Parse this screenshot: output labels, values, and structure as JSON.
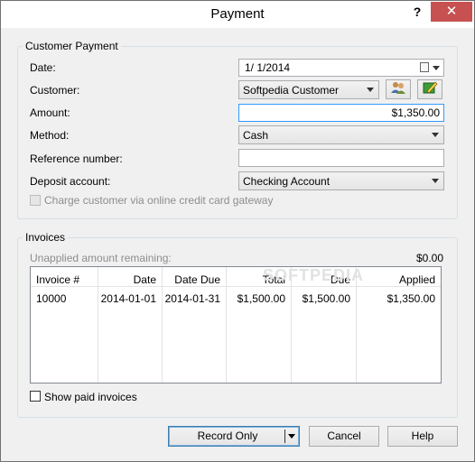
{
  "window": {
    "title": "Payment",
    "help_glyph": "?",
    "close_glyph": "✕"
  },
  "customer_payment": {
    "group_title": "Customer Payment",
    "date_label": "Date:",
    "date_value": "1/  1/2014",
    "customer_label": "Customer:",
    "customer_value": "Softpedia Customer",
    "amount_label": "Amount:",
    "amount_value": "$1,350.00",
    "method_label": "Method:",
    "method_value": "Cash",
    "reference_label": "Reference number:",
    "reference_value": "",
    "deposit_label": "Deposit account:",
    "deposit_value": "Checking Account",
    "charge_online_label": "Charge customer via online credit card gateway"
  },
  "invoices": {
    "group_title": "Invoices",
    "unapplied_label": "Unapplied amount remaining:",
    "unapplied_value": "$0.00",
    "columns": [
      "Invoice #",
      "Date",
      "Date Due",
      "Total",
      "Due",
      "Applied"
    ],
    "rows": [
      {
        "invoice": "10000",
        "date": "2014-01-01",
        "date_due": "2014-01-31",
        "total": "$1,500.00",
        "due": "$1,500.00",
        "applied": "$1,350.00"
      }
    ],
    "show_paid_label": "Show paid invoices",
    "watermark": "SOFTPEDIA"
  },
  "buttons": {
    "record_only": "Record Only",
    "cancel": "Cancel",
    "help": "Help"
  }
}
